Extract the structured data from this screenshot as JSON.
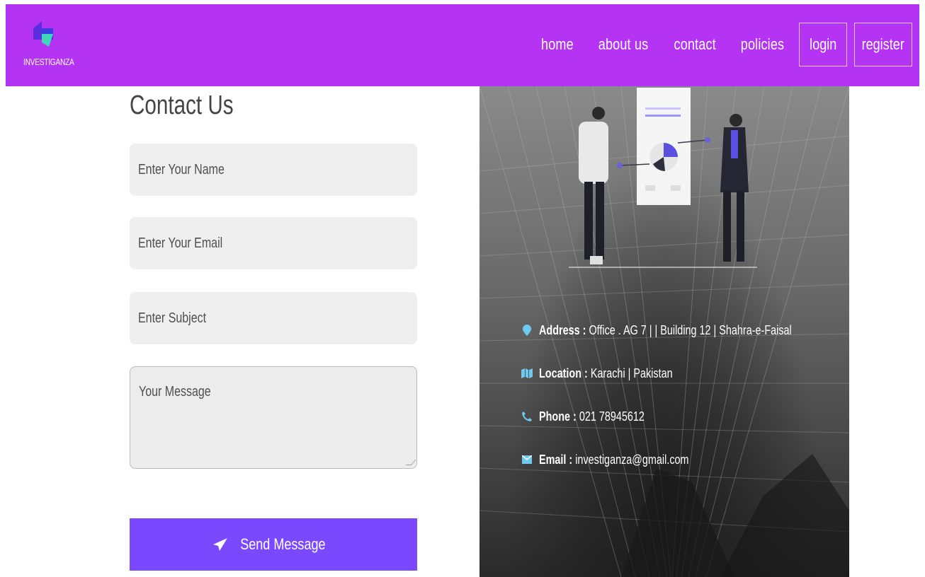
{
  "brand": {
    "name": "INVESTIGANZA"
  },
  "nav": {
    "links": [
      "home",
      "about us",
      "contact",
      "policies"
    ],
    "login": "login",
    "register": "register"
  },
  "form": {
    "title": "Contact Us",
    "name_placeholder": "Enter Your Name",
    "email_placeholder": "Enter Your Email",
    "subject_placeholder": "Enter Subject",
    "message_placeholder": "Your Message",
    "send_label": "Send Message"
  },
  "info": {
    "address_key": "Address :",
    "address_val": "Office . AG 7 | | Building 12 | Shahra-e-Faisal",
    "location_key": "Location :",
    "location_val": "Karachi | Pakistan",
    "phone_key": "Phone :",
    "phone_val": "021 78945612",
    "email_key": "Email :",
    "email_val": "investiganza@gmail.com"
  },
  "colors": {
    "navbar": "#b534f3",
    "send_button": "#7a48ff",
    "info_icon": "#6ec8f0"
  },
  "icons": {
    "send": "paper-plane-icon",
    "address": "map-marker-icon",
    "location": "map-icon",
    "phone": "phone-icon",
    "email": "envelope-icon"
  }
}
